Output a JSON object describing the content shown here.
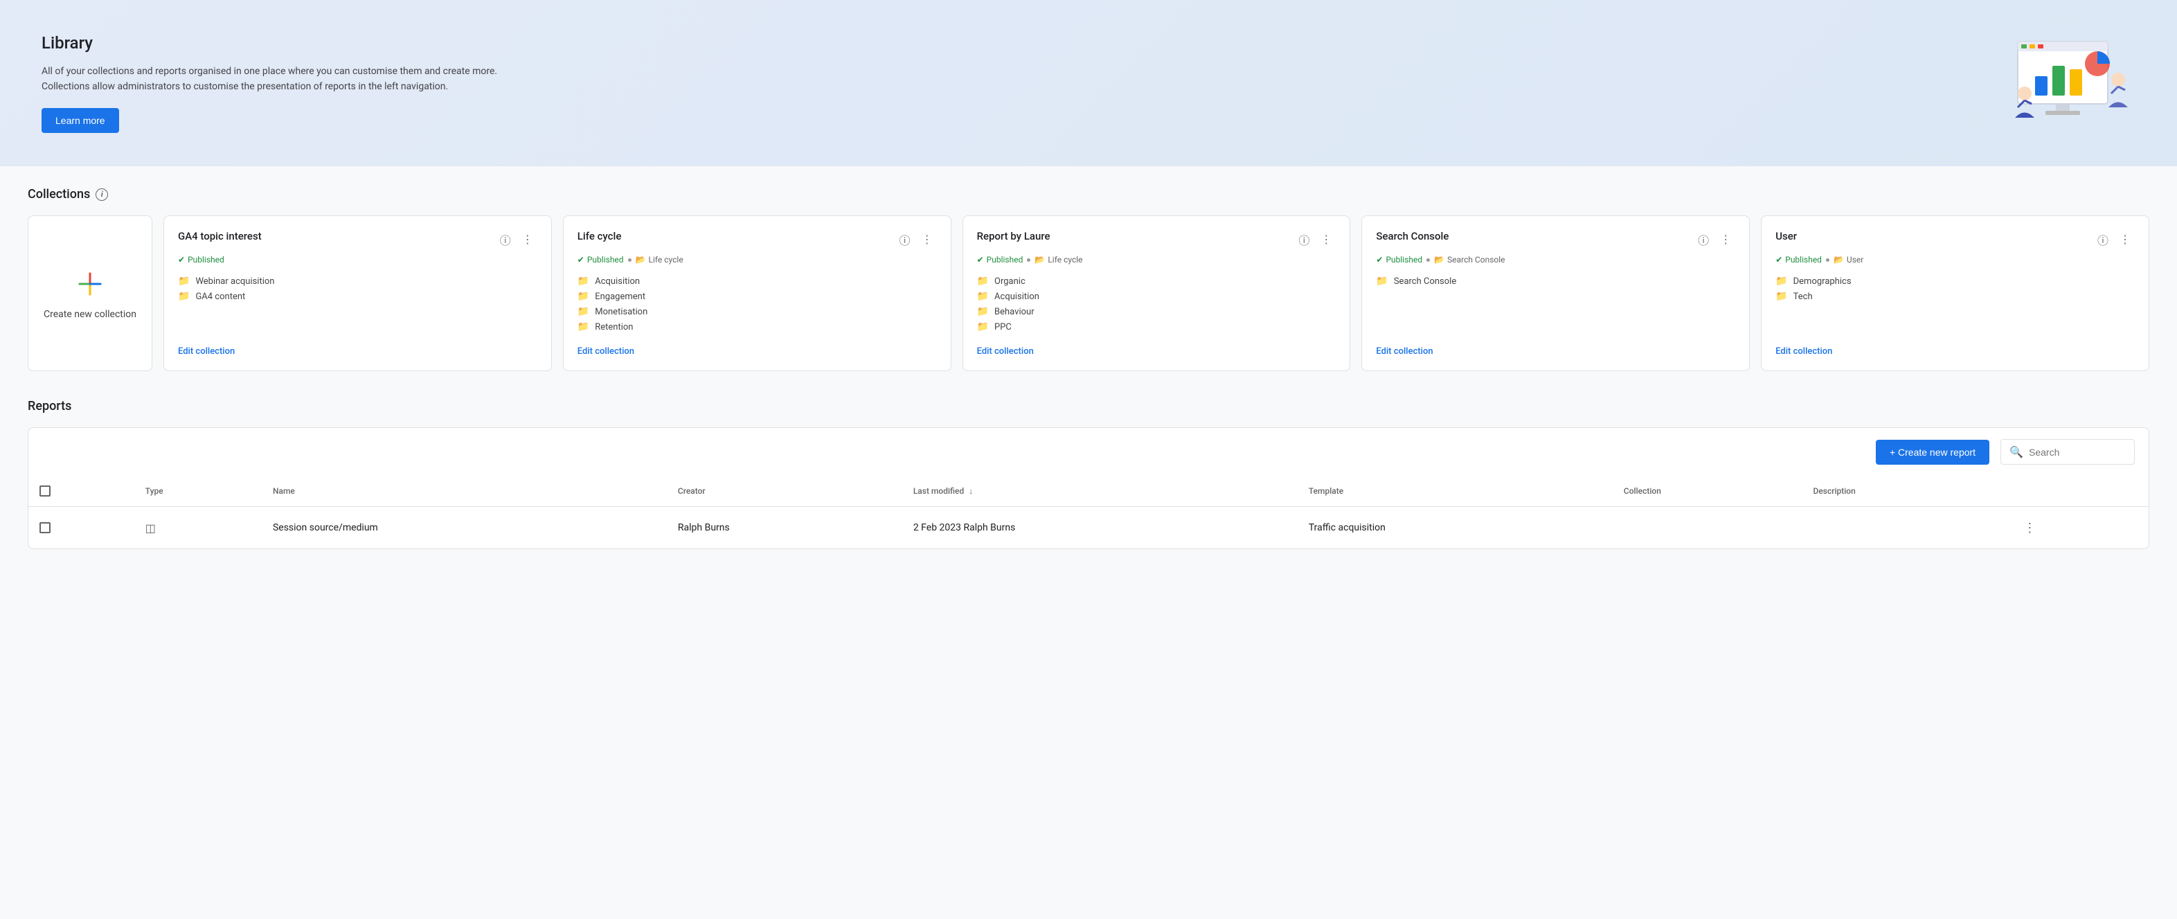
{
  "hero": {
    "title": "Library",
    "description": "All of your collections and reports organised in one place where you can customise them and create more. Collections allow administrators to customise the presentation of reports in the left navigation.",
    "learn_more_label": "Learn more"
  },
  "collections_section": {
    "title": "Collections",
    "info_icon": "i"
  },
  "new_collection": {
    "label": "Create new collection"
  },
  "collections": [
    {
      "id": "ga4-topic-interest",
      "title": "GA4 topic interest",
      "status": "Published",
      "tags": [],
      "reports": [
        "Webinar acquisition",
        "GA4 content"
      ],
      "edit_label": "Edit collection"
    },
    {
      "id": "life-cycle",
      "title": "Life cycle",
      "status": "Published",
      "tags": [
        "Life cycle"
      ],
      "reports": [
        "Acquisition",
        "Engagement",
        "Monetisation",
        "Retention"
      ],
      "edit_label": "Edit collection"
    },
    {
      "id": "report-by-laure",
      "title": "Report by Laure",
      "status": "Published",
      "tags": [
        "Life cycle"
      ],
      "reports": [
        "Organic",
        "Acquisition",
        "Behaviour",
        "PPC"
      ],
      "edit_label": "Edit collection"
    },
    {
      "id": "search-console",
      "title": "Search Console",
      "status": "Published",
      "tags": [
        "Search Console"
      ],
      "reports": [
        "Search Console"
      ],
      "edit_label": "Edit collection"
    },
    {
      "id": "user",
      "title": "User",
      "status": "Published",
      "tags": [
        "User"
      ],
      "reports": [
        "Demographics",
        "Tech"
      ],
      "edit_label": "Edit collection"
    }
  ],
  "reports_section": {
    "title": "Reports",
    "create_report_label": "+ Create new report",
    "search_placeholder": "Search",
    "table": {
      "columns": [
        {
          "key": "type",
          "label": "Type"
        },
        {
          "key": "name",
          "label": "Name"
        },
        {
          "key": "creator",
          "label": "Creator"
        },
        {
          "key": "last_modified",
          "label": "Last modified",
          "sortable": true
        },
        {
          "key": "template",
          "label": "Template"
        },
        {
          "key": "collection",
          "label": "Collection"
        },
        {
          "key": "description",
          "label": "Description"
        }
      ],
      "rows": [
        {
          "type": "table",
          "name": "Session source/medium",
          "creator": "Ralph Burns",
          "last_modified": "2 Feb 2023 Ralph Burns",
          "template": "Traffic acquisition",
          "collection": "",
          "description": ""
        }
      ]
    }
  }
}
